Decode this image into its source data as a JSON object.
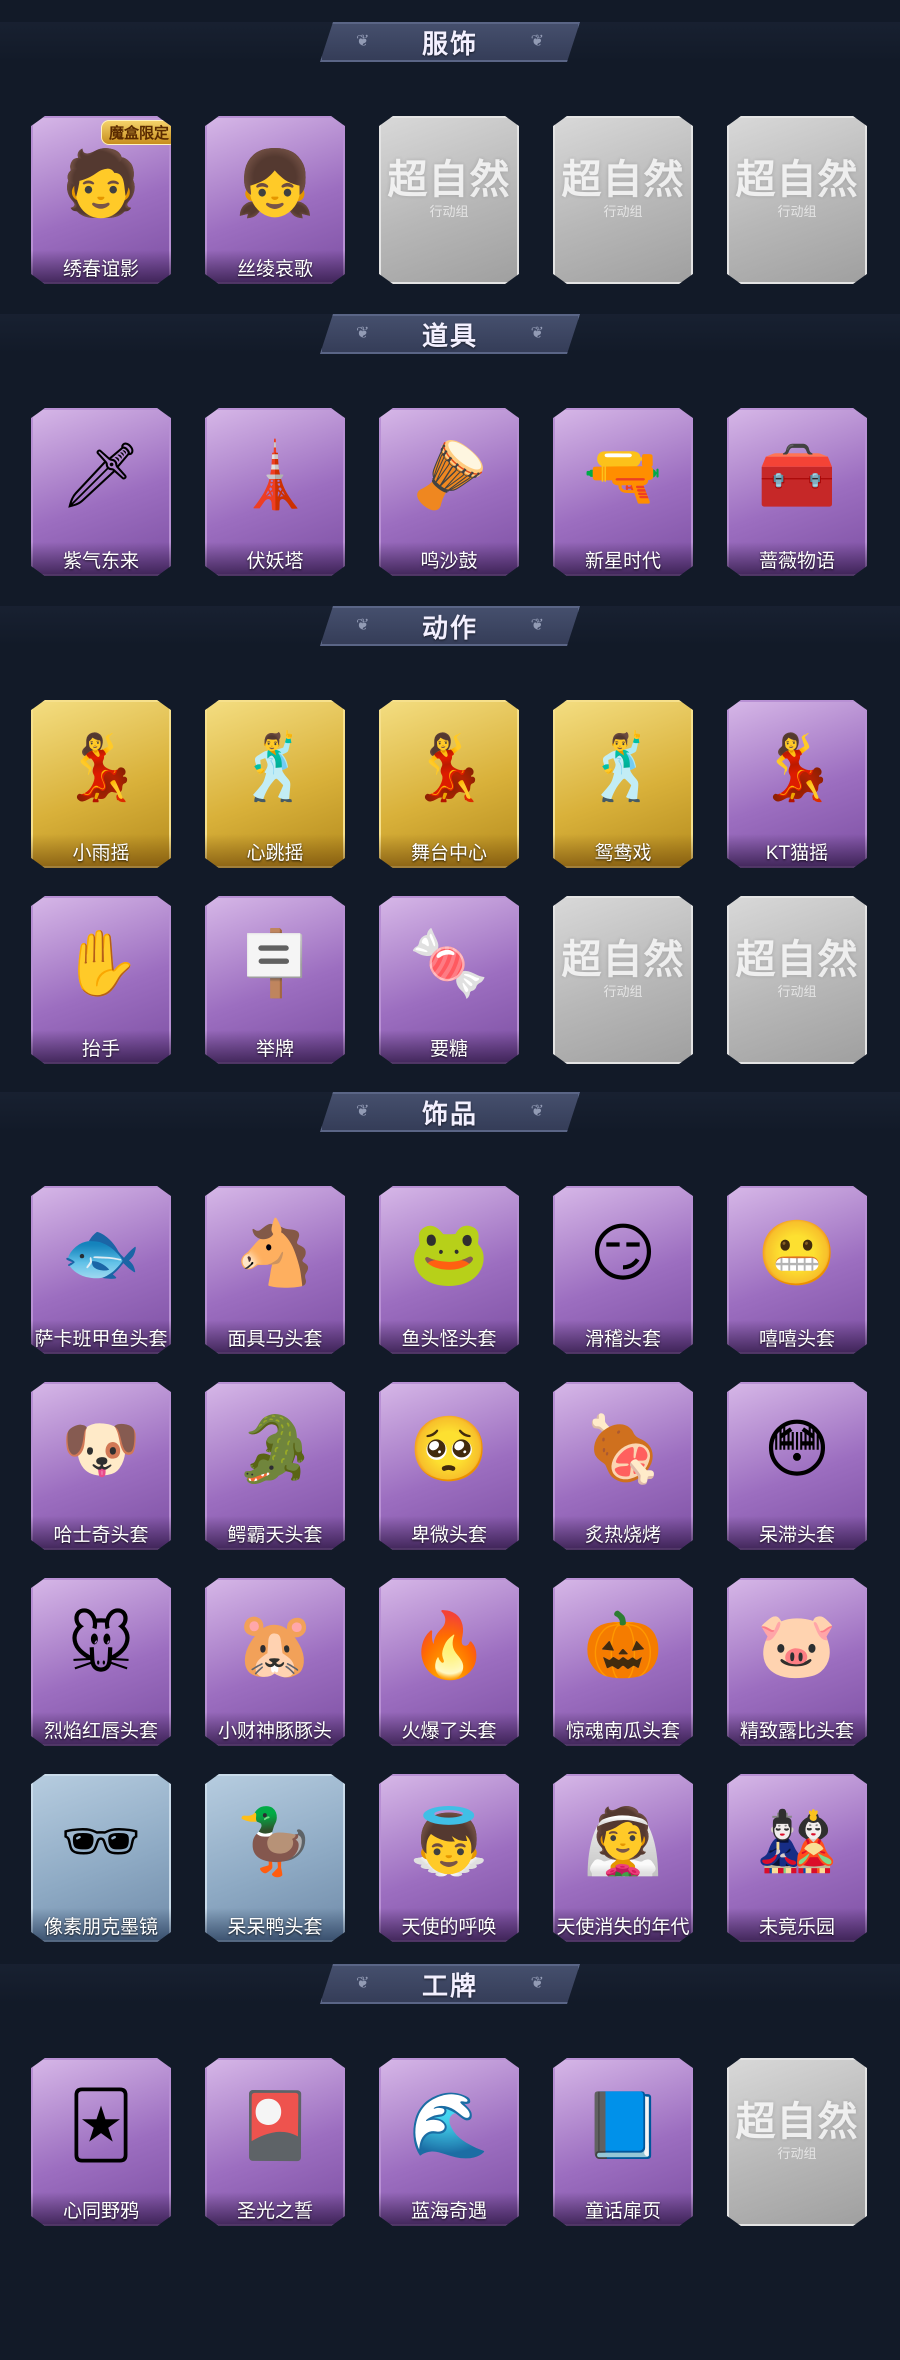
{
  "sections": [
    {
      "title": "服饰",
      "items": [
        {
          "label": "绣春谊影",
          "tier": "purple",
          "icon": "portrait-male-icon",
          "glyph": "🧑",
          "badge": "魔盒限定"
        },
        {
          "label": "丝绫哀歌",
          "tier": "purple",
          "icon": "portrait-female-icon",
          "glyph": "👧",
          "badge": ""
        },
        {
          "label": "",
          "tier": "silver",
          "icon": "watermark-logo-icon",
          "glyph": "",
          "watermark": {
            "title": "超自然",
            "sub": "行动组"
          }
        },
        {
          "label": "",
          "tier": "silver",
          "icon": "watermark-logo-icon",
          "glyph": "",
          "watermark": {
            "title": "超自然",
            "sub": "行动组"
          }
        },
        {
          "label": "",
          "tier": "silver",
          "icon": "watermark-logo-icon",
          "glyph": "",
          "watermark": {
            "title": "超自然",
            "sub": "行动组"
          }
        }
      ]
    },
    {
      "title": "道具",
      "items": [
        {
          "label": "紫气东来",
          "tier": "purple",
          "icon": "sword-icon",
          "glyph": "🗡"
        },
        {
          "label": "伏妖塔",
          "tier": "purple",
          "icon": "pagoda-icon",
          "glyph": "🗼"
        },
        {
          "label": "鸣沙鼓",
          "tier": "purple",
          "icon": "drum-icon",
          "glyph": "🪘"
        },
        {
          "label": "新星时代",
          "tier": "purple",
          "icon": "revolver-icon",
          "glyph": "🔫"
        },
        {
          "label": "蔷薇物语",
          "tier": "purple",
          "icon": "medkit-icon",
          "glyph": "🧰"
        }
      ]
    },
    {
      "title": "动作",
      "items": [
        {
          "label": "小雨摇",
          "tier": "gold",
          "icon": "dance-pose-icon",
          "glyph": "💃"
        },
        {
          "label": "心跳摇",
          "tier": "gold",
          "icon": "dance-pose-icon",
          "glyph": "🕺"
        },
        {
          "label": "舞台中心",
          "tier": "gold",
          "icon": "dance-pose-icon",
          "glyph": "💃"
        },
        {
          "label": "鸳鸯戏",
          "tier": "gold",
          "icon": "dance-pose-icon",
          "glyph": "🕺"
        },
        {
          "label": "KT猫摇",
          "tier": "purple",
          "icon": "dance-pose-icon",
          "glyph": "💃"
        },
        {
          "label": "抬手",
          "tier": "purple",
          "icon": "raise-hand-icon",
          "glyph": "✋"
        },
        {
          "label": "举牌",
          "tier": "purple",
          "icon": "sign-board-icon",
          "glyph": "🪧"
        },
        {
          "label": "要糖",
          "tier": "purple",
          "icon": "candy-request-icon",
          "glyph": "🍬"
        },
        {
          "label": "",
          "tier": "silver",
          "icon": "watermark-logo-icon",
          "glyph": "",
          "watermark": {
            "title": "超自然",
            "sub": "行动组"
          }
        },
        {
          "label": "",
          "tier": "silver",
          "icon": "watermark-logo-icon",
          "glyph": "",
          "watermark": {
            "title": "超自然",
            "sub": "行动组"
          }
        }
      ]
    },
    {
      "title": "饰品",
      "items": [
        {
          "label": "萨卡班甲鱼头套",
          "tier": "purple",
          "icon": "fish-head-icon",
          "glyph": "🐟"
        },
        {
          "label": "面具马头套",
          "tier": "purple",
          "icon": "horse-head-icon",
          "glyph": "🐴"
        },
        {
          "label": "鱼头怪头套",
          "tier": "purple",
          "icon": "fish-monster-icon",
          "glyph": "🐸"
        },
        {
          "label": "滑稽头套",
          "tier": "purple",
          "icon": "funny-face-icon",
          "glyph": "😏"
        },
        {
          "label": "嘻嘻头套",
          "tier": "purple",
          "icon": "grin-face-icon",
          "glyph": "😬"
        },
        {
          "label": "哈士奇头套",
          "tier": "purple",
          "icon": "husky-head-icon",
          "glyph": "🐶"
        },
        {
          "label": "鳄霸天头套",
          "tier": "purple",
          "icon": "crocodile-head-icon",
          "glyph": "🐊"
        },
        {
          "label": "卑微头套",
          "tier": "purple",
          "icon": "humble-face-icon",
          "glyph": "🥺"
        },
        {
          "label": "炙热烧烤",
          "tier": "purple",
          "icon": "grilled-meat-icon",
          "glyph": "🍖"
        },
        {
          "label": "呆滞头套",
          "tier": "purple",
          "icon": "dazed-face-icon",
          "glyph": "😳"
        },
        {
          "label": "烈焰红唇头套",
          "tier": "purple",
          "icon": "yellow-mouse-head-icon",
          "glyph": "🐭"
        },
        {
          "label": "小财神豚豚头",
          "tier": "purple",
          "icon": "capybara-head-icon",
          "glyph": "🐹"
        },
        {
          "label": "火爆了头套",
          "tier": "purple",
          "icon": "flame-head-icon",
          "glyph": "🔥"
        },
        {
          "label": "惊魂南瓜头套",
          "tier": "purple",
          "icon": "pumpkin-head-icon",
          "glyph": "🎃"
        },
        {
          "label": "精致露比头套",
          "tier": "purple",
          "icon": "pink-creature-head-icon",
          "glyph": "🐷"
        },
        {
          "label": "像素朋克墨镜",
          "tier": "blue",
          "icon": "pixel-sunglasses-icon",
          "glyph": "🕶"
        },
        {
          "label": "呆呆鸭头套",
          "tier": "blue",
          "icon": "duck-head-icon",
          "glyph": "🦆"
        },
        {
          "label": "天使的呼唤",
          "tier": "purple",
          "icon": "angel-figure-icon",
          "glyph": "👼"
        },
        {
          "label": "天使消失的年代",
          "tier": "purple",
          "icon": "angel-girl-icon",
          "glyph": "👰"
        },
        {
          "label": "未竟乐园",
          "tier": "purple",
          "icon": "doll-figure-icon",
          "glyph": "🎎"
        }
      ]
    },
    {
      "title": "工牌",
      "items": [
        {
          "label": "心同野鸦",
          "tier": "purple",
          "icon": "card-gold-icon",
          "glyph": "🃏"
        },
        {
          "label": "圣光之誓",
          "tier": "purple",
          "icon": "card-holy-icon",
          "glyph": "🎴"
        },
        {
          "label": "蓝海奇遇",
          "tier": "purple",
          "icon": "card-ocean-icon",
          "glyph": "🌊"
        },
        {
          "label": "童话扉页",
          "tier": "purple",
          "icon": "card-fairytale-icon",
          "glyph": "📘"
        },
        {
          "label": "",
          "tier": "silver",
          "icon": "watermark-logo-icon",
          "glyph": "",
          "watermark": {
            "title": "超自然",
            "sub": "行动组"
          }
        }
      ]
    }
  ]
}
